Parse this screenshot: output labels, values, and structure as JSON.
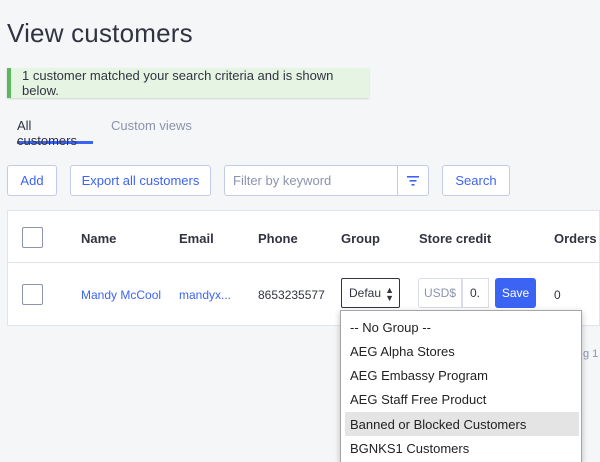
{
  "page": {
    "title": "View customers"
  },
  "alert": {
    "message": "1 customer matched your search criteria and is shown below."
  },
  "tabs": [
    {
      "label": "All customers",
      "active": true
    },
    {
      "label": "Custom views",
      "active": false
    }
  ],
  "toolbar": {
    "add_label": "Add",
    "export_label": "Export all customers",
    "filter_placeholder": "Filter by keyword",
    "search_label": "Search"
  },
  "table": {
    "headers": {
      "name": "Name",
      "email": "Email",
      "phone": "Phone",
      "group": "Group",
      "store_credit": "Store credit",
      "orders": "Orders"
    },
    "rows": [
      {
        "name": "Mandy McCool",
        "email": "mandyx...",
        "phone": "8653235577",
        "group": "Defau",
        "currency": "USD$",
        "credit": "0.",
        "save_label": "Save",
        "orders": "0"
      }
    ]
  },
  "group_dropdown": {
    "options": [
      "-- No Group --",
      "AEG Alpha Stores",
      "AEG Embassy Program",
      "AEG Staff Free Product",
      "Banned or Blocked Customers",
      "BGNKS1 Customers"
    ],
    "highlighted": "Banned or Blocked Customers"
  },
  "pagination_peek": "g 1 o",
  "colors": {
    "accent": "#3c64f4",
    "success": "#5cb85c",
    "alert_bg": "#e6f4e3"
  }
}
